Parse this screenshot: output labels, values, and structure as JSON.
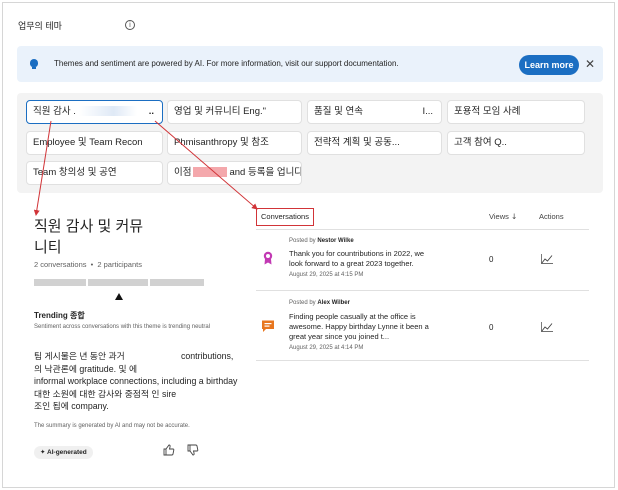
{
  "header": {
    "title": "업무의 테마",
    "info_icon": "info-icon"
  },
  "banner": {
    "icon": "lightbulb-icon",
    "text": "Themes and sentiment are powered by AI. For more information, visit our support documentation.",
    "learn_more": "Learn more",
    "close_icon": "close-icon"
  },
  "themes": [
    {
      "label_a": "직원 감사 .",
      "label_b": "..",
      "selected": true
    },
    {
      "label": "영업 및 커뮤니티 Eng.\""
    },
    {
      "label_a": "품질 및 연속",
      "label_b": "I..."
    },
    {
      "label": "포용적 모임 사례"
    },
    {
      "label": "Employee 및 Team Recon"
    },
    {
      "label": "Phmisanthropy 및 참조"
    },
    {
      "label": "전략적 계획 및 공동..."
    },
    {
      "label": "고객 참여 Q.."
    },
    {
      "label": "Team 창의성 및 공연"
    },
    {
      "label_a": "이점",
      "label_b": "and 등록을 업니다.\""
    }
  ],
  "detail": {
    "title": "직원 감사 및 커뮤니티",
    "conversations": "2 conversations",
    "separator": "•",
    "participants": "2 participants",
    "trending_label": "Trending 종합",
    "trending_sub": "Sentiment across conversations with this theme is trending neutral",
    "summary_lines": [
      {
        "a": "팀 게시물은 년 동안 과거",
        "b": "contributions,"
      },
      {
        "a": "의 낙관론에 gratitude. 및 에"
      },
      {
        "a": "informal workplace connections, including a birthday"
      },
      {
        "a": "대한 소원에 대한 감사와 중점적 인 sire"
      },
      {
        "a": "조인 됩에 company."
      }
    ],
    "disclaimer": "The summary is generated by AI and may not be accurate.",
    "ai_badge": "AI-generated",
    "like_icon": "thumbs-up-icon",
    "dislike_icon": "thumbs-down-icon"
  },
  "conversations": {
    "tab_label": "Conversations",
    "views_header": "Views",
    "actions_header": "Actions",
    "rows": [
      {
        "posted_by": "Posted by",
        "author": "Nestor Wilke",
        "text": "Thank you for countributions in 2022, we look forward to a great 2023 together.",
        "date": "August 29, 2025 at 4:15 PM",
        "views": "0",
        "icon": "award-ribbon-icon",
        "icon_color": "#c239b3"
      },
      {
        "posted_by": "Posted by",
        "author": "Alex Wilber",
        "text": "Finding people casually at the office is awesome. Happy birthday Lynne it been a great year since you joined t...",
        "date": "August 29, 2025 at 4:14 PM",
        "views": "0",
        "icon": "chat-bubble-icon",
        "icon_color": "#e8761e"
      }
    ]
  },
  "colors": {
    "accent": "#1b6ec2",
    "annotation_red": "#d13438"
  }
}
